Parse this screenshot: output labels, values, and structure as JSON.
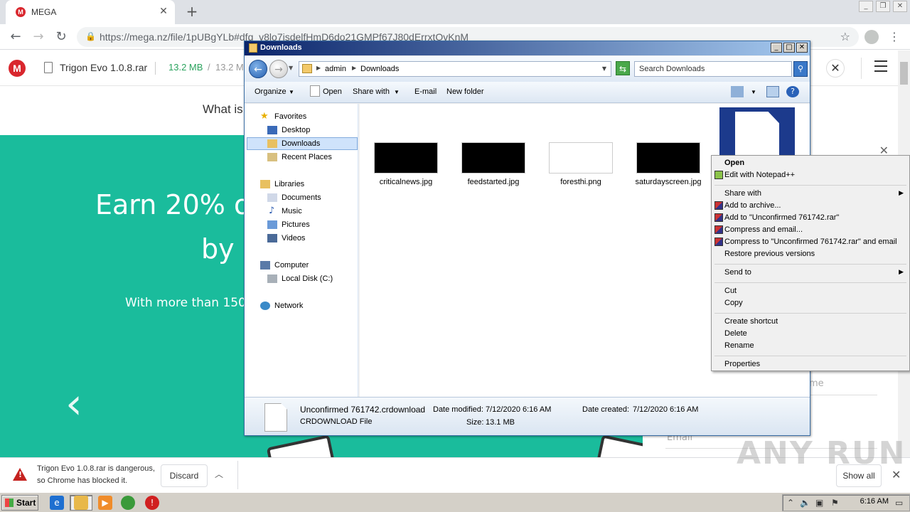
{
  "browser": {
    "tab_title": "MEGA",
    "url": "https://mega.nz/file/1pUBgYLb#dfq_v8lo7isdelfHmD6do21GMPf67J80dErrxtOvKnM"
  },
  "mega": {
    "filename": "Trigon Evo 1.0.8.rar",
    "size_done": "13.2 MB",
    "size_sep": "/",
    "size_total": "13.2 M",
    "what_text": "What is",
    "earn_line1": "Earn 20% o",
    "earn_line2": "by a",
    "earn_line3": "With more than 150 r",
    "name_placeholder": "me",
    "email_placeholder": "Email"
  },
  "downloads_bar": {
    "warning_line1": "Trigon Evo 1.0.8.rar is dangerous,",
    "warning_line2": "so Chrome has blocked it.",
    "discard_label": "Discard",
    "show_all_label": "Show all"
  },
  "watermark": "ANY RUN",
  "explorer": {
    "title": "Downloads",
    "breadcrumb": [
      "admin",
      "Downloads"
    ],
    "search_placeholder": "Search Downloads",
    "commands": {
      "organize": "Organize",
      "open": "Open",
      "share_with": "Share with",
      "email": "E-mail",
      "new_folder": "New folder"
    },
    "nav": {
      "favorites": "Favorites",
      "desktop": "Desktop",
      "downloads": "Downloads",
      "recent_places": "Recent Places",
      "libraries": "Libraries",
      "documents": "Documents",
      "music": "Music",
      "pictures": "Pictures",
      "videos": "Videos",
      "computer": "Computer",
      "local_disk": "Local Disk (C:)",
      "network": "Network"
    },
    "files": [
      {
        "name": "criticalnews.jpg",
        "thumb": "black"
      },
      {
        "name": "feedstarted.jpg",
        "thumb": "black"
      },
      {
        "name": "foresthi.png",
        "thumb": "white"
      },
      {
        "name": "saturdayscreen.jpg",
        "thumb": "black"
      }
    ],
    "details": {
      "name": "Unconfirmed 761742.crdownload",
      "type": "CRDOWNLOAD File",
      "modified_label": "Date modified:",
      "modified_value": "7/12/2020 6:16 AM",
      "created_label": "Date created:",
      "created_value": "7/12/2020 6:16 AM",
      "size_label": "Size:",
      "size_value": "13.1 MB"
    }
  },
  "context_menu": {
    "open": "Open",
    "edit_notepad": "Edit with Notepad++",
    "share_with": "Share with",
    "add_archive": "Add to archive...",
    "add_to_rar": "Add to \"Unconfirmed 761742.rar\"",
    "compress_email": "Compress and email...",
    "compress_to_rar_email": "Compress to \"Unconfirmed 761742.rar\" and email",
    "restore_versions": "Restore previous versions",
    "send_to": "Send to",
    "cut": "Cut",
    "copy": "Copy",
    "create_shortcut": "Create shortcut",
    "delete": "Delete",
    "rename": "Rename",
    "properties": "Properties"
  },
  "taskbar": {
    "start_label": "Start",
    "clock": "6:16 AM"
  }
}
